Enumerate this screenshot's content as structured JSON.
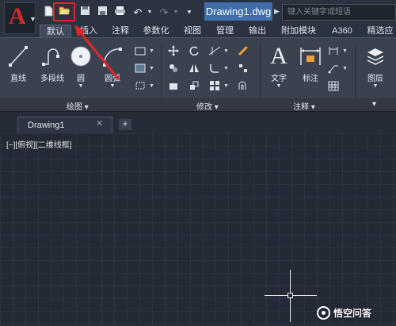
{
  "title_bar": {
    "document_title": "Drawing1.dwg",
    "search_placeholder": "键入关键字或短语"
  },
  "ribbon_tabs": [
    "默认",
    "插入",
    "注释",
    "参数化",
    "视图",
    "管理",
    "输出",
    "附加模块",
    "A360",
    "精选应"
  ],
  "active_tab": "默认",
  "draw_panel": {
    "title": "绘图",
    "tools": [
      "直线",
      "多段线",
      "圆",
      "圆弧"
    ]
  },
  "modify_panel": {
    "title": "修改"
  },
  "annotation_panel": {
    "title": "注释",
    "tools": [
      "文字",
      "标注"
    ]
  },
  "layers_panel": {
    "tools": [
      "图层"
    ]
  },
  "document_tabs": [
    "Drawing1"
  ],
  "viewport_label": "[−][俯视][二维线框]",
  "watermark": "悟空问答",
  "colors": {
    "accent": "#3f6eaa",
    "highlight": "#e0262a",
    "app_logo": "#d42a2a",
    "canvas_bg": "#232935"
  }
}
